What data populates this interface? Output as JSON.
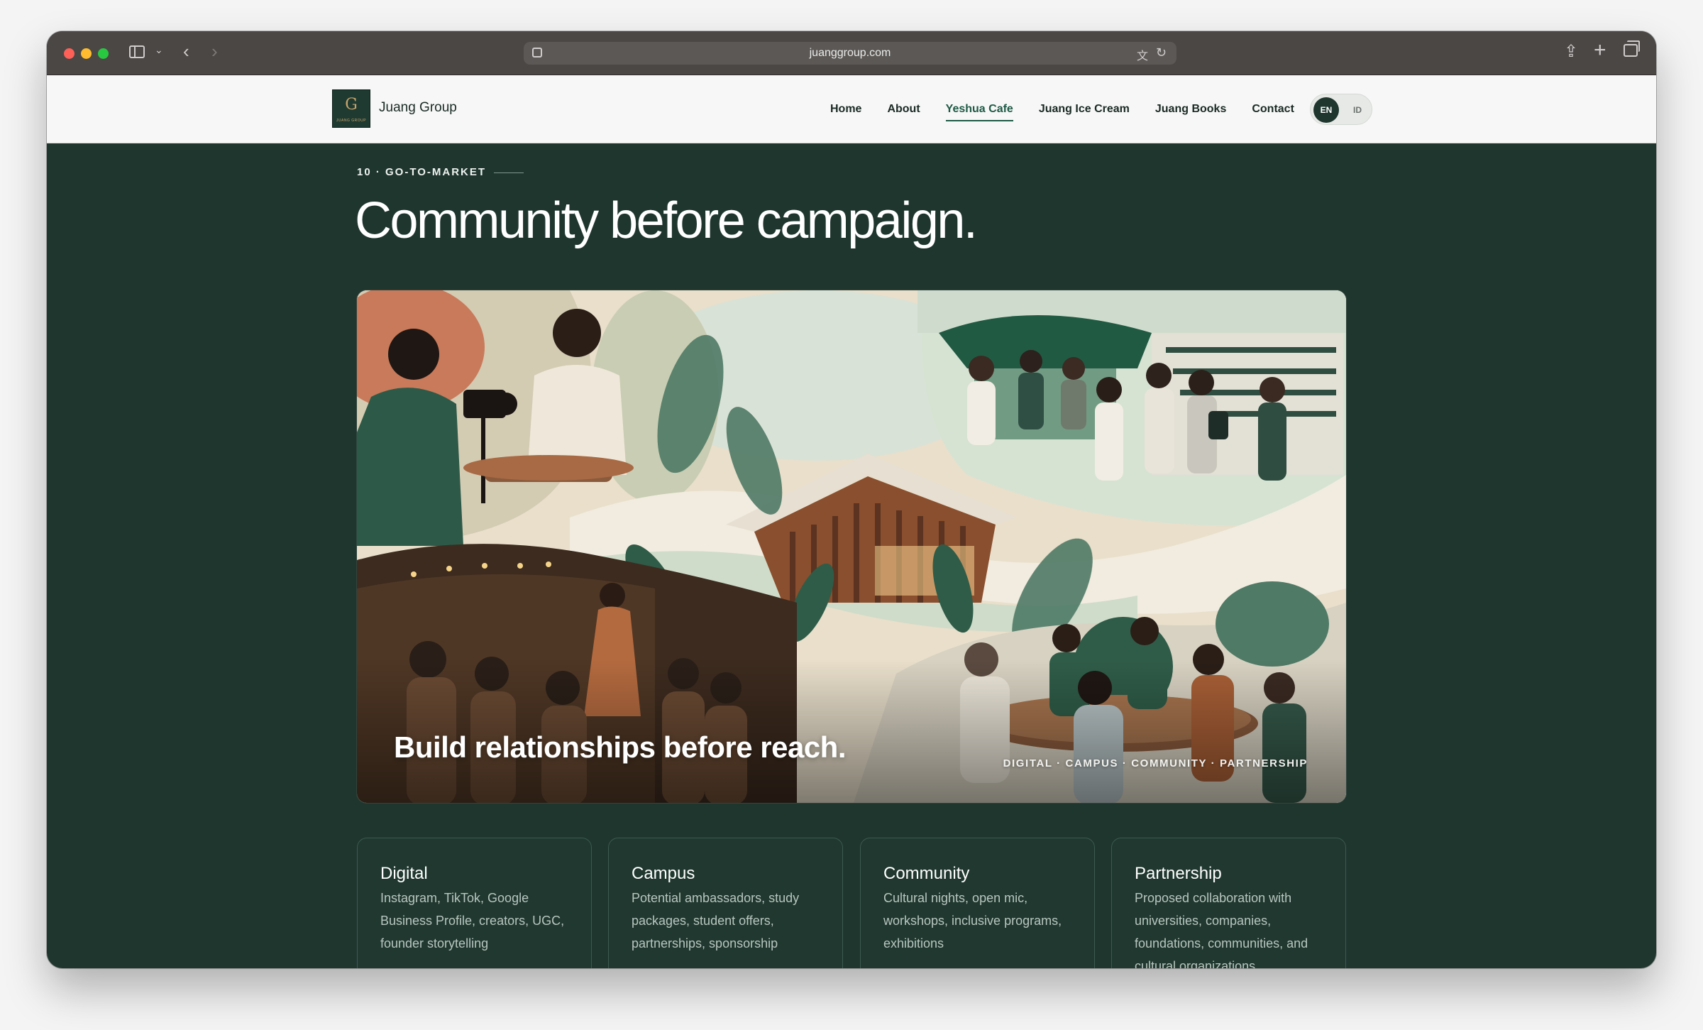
{
  "browser": {
    "url": "juanggroup.com"
  },
  "site": {
    "logo_glyph": "G",
    "logo_subtext": "JUANG GROUP",
    "brand": "Juang Group",
    "nav": [
      "Home",
      "About",
      "Yeshua Cafe",
      "Juang Ice Cream",
      "Juang Books",
      "Contact"
    ],
    "active_nav": "Yeshua Cafe",
    "lang": {
      "en": "EN",
      "id": "ID"
    }
  },
  "section": {
    "label": "10 · GO-TO-MARKET",
    "headline": "Community before campaign.",
    "hero_caption": "Build relationships before reach.",
    "hero_tags": "DIGITAL · CAMPUS · COMMUNITY · PARTNERSHIP"
  },
  "cards": [
    {
      "title": "Digital",
      "body": "Instagram, TikTok, Google Business Profile, creators, UGC, founder storytelling"
    },
    {
      "title": "Campus",
      "body": "Potential ambassadors, study packages, student offers, partnerships, sponsorship"
    },
    {
      "title": "Community",
      "body": "Cultural nights, open mic, workshops, inclusive programs, exhibitions"
    },
    {
      "title": "Partnership",
      "body": "Proposed collaboration with universities, companies, foundations, communities, and cultural organizations"
    }
  ],
  "colors": {
    "page_bg": "#1f362f",
    "accent": "#1e5a46",
    "header_bg": "#f6f7f6"
  }
}
